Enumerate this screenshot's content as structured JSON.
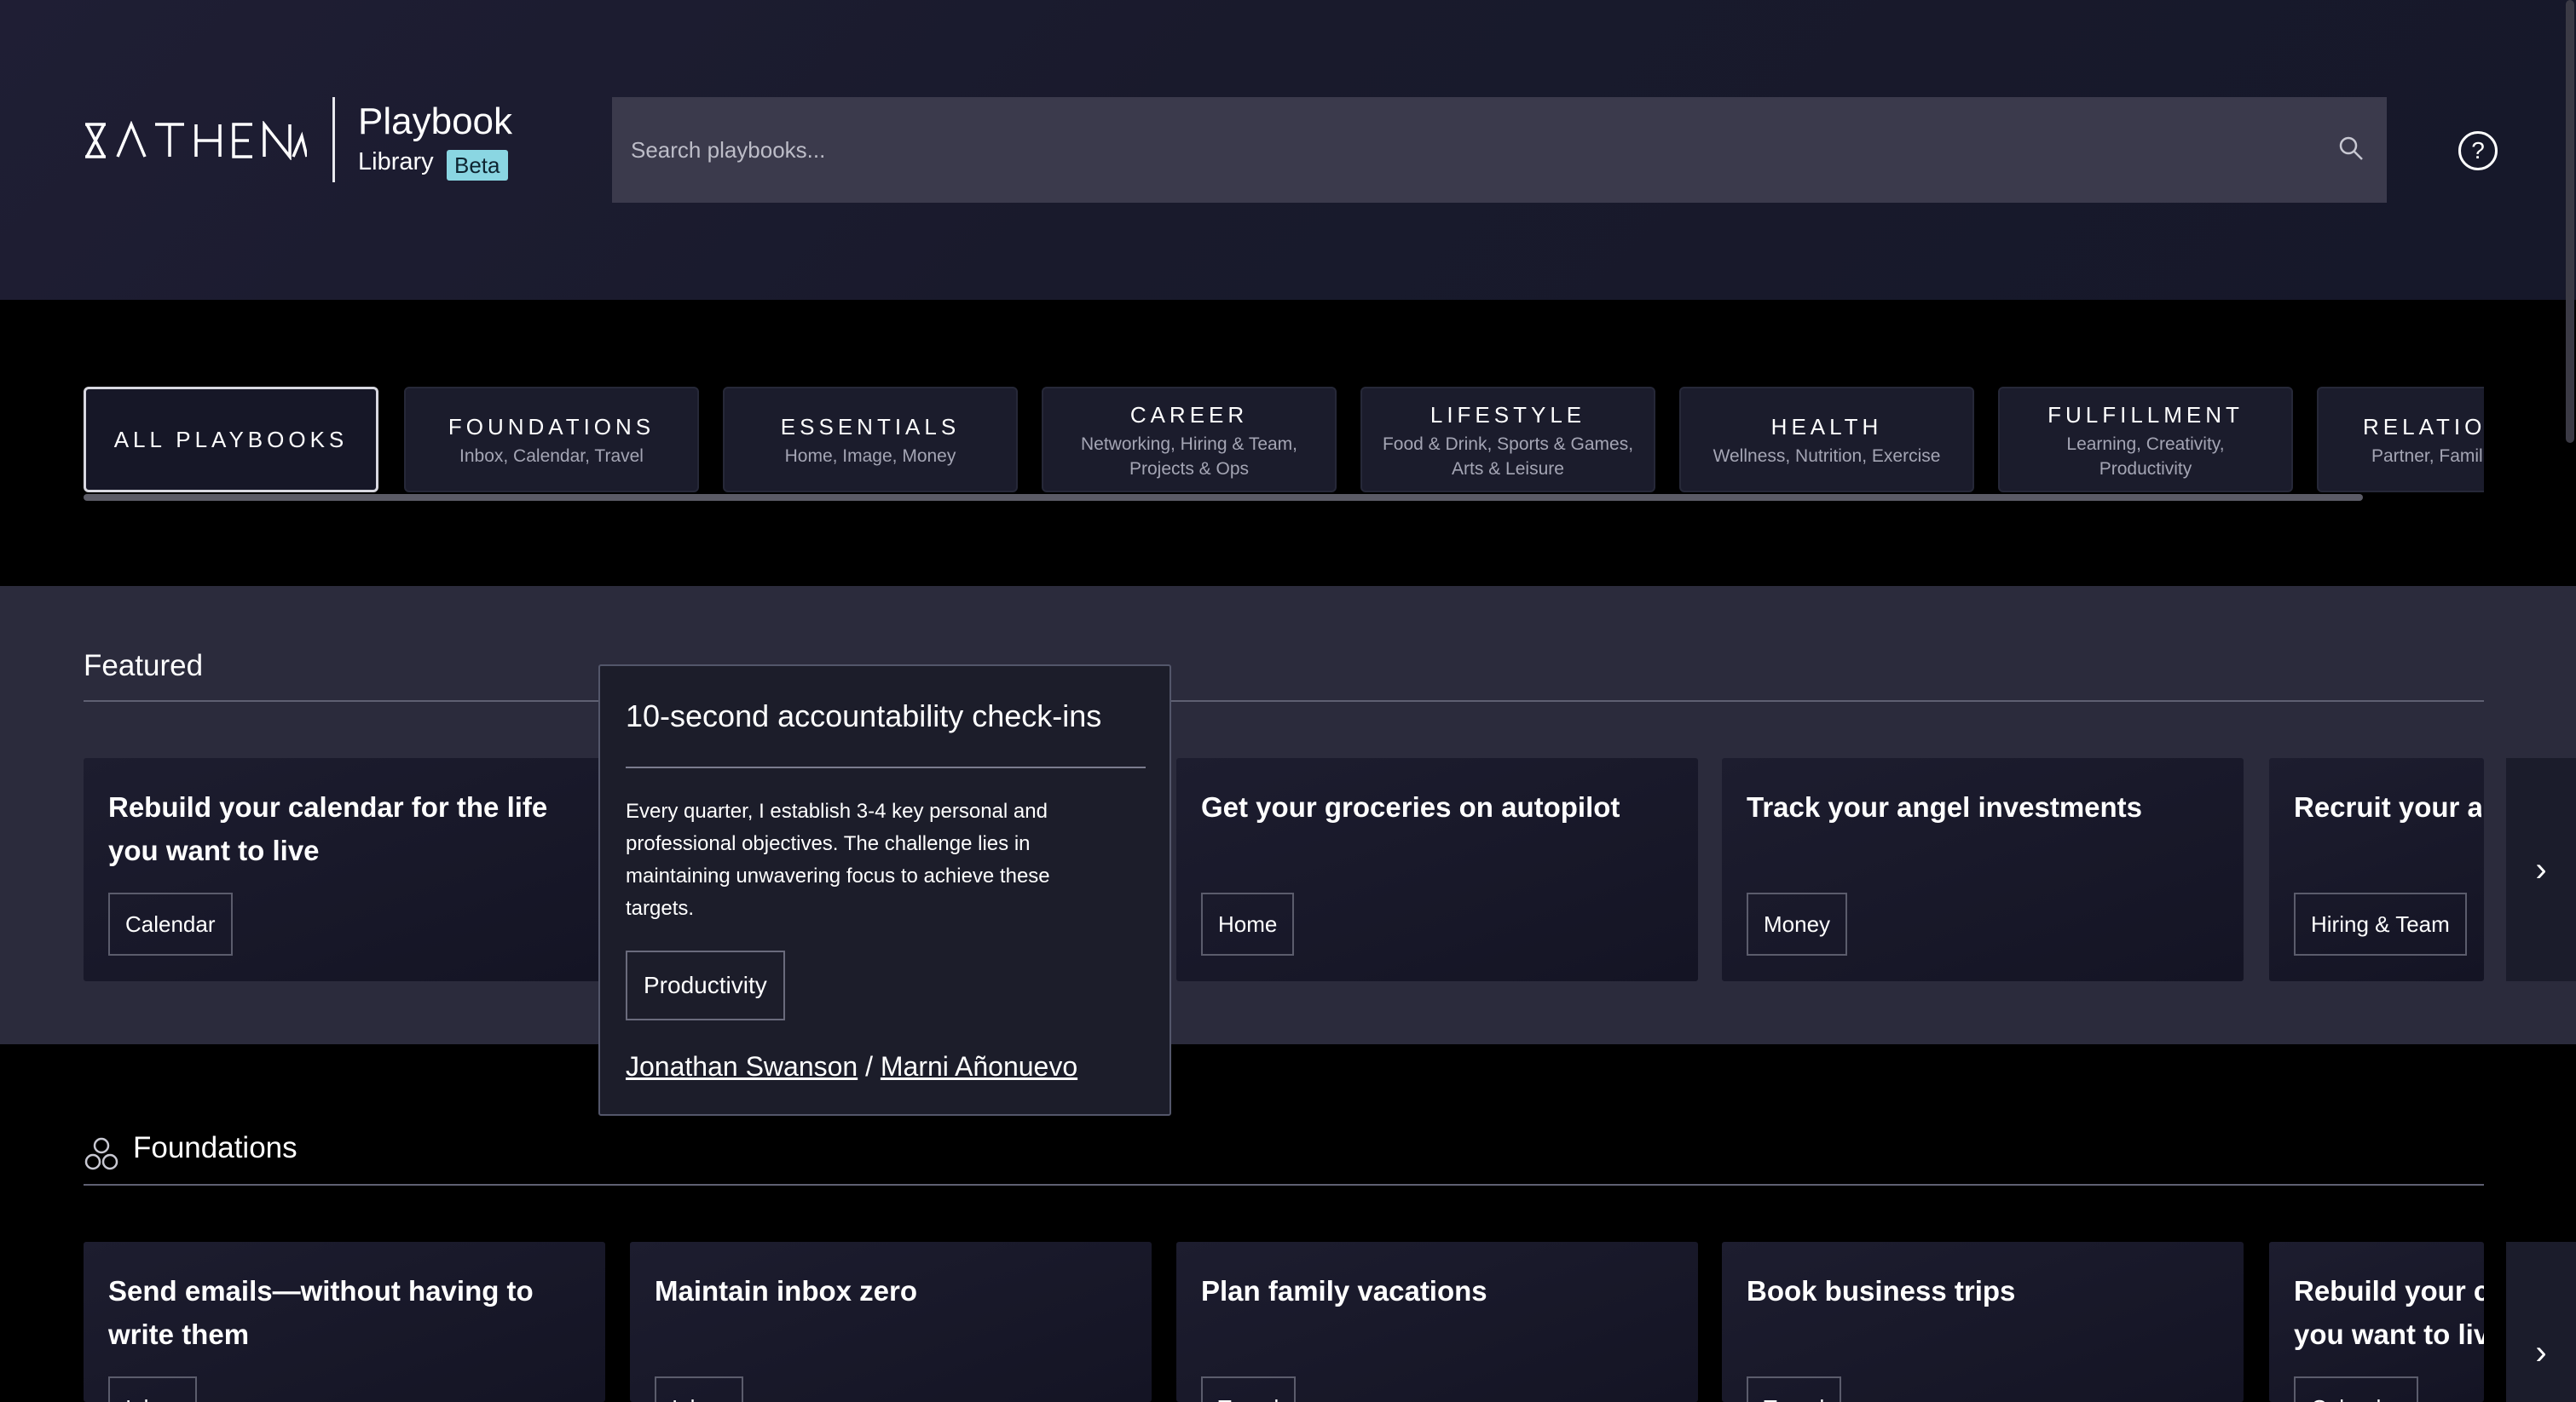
{
  "header": {
    "logo_text": "ATHENA",
    "title": "Playbook",
    "subtitle": "Library",
    "badge": "Beta",
    "search_placeholder": "Search playbooks...",
    "help_label": "?"
  },
  "tabs": [
    {
      "title": "ALL PLAYBOOKS",
      "desc": ""
    },
    {
      "title": "FOUNDATIONS",
      "desc": "Inbox, Calendar, Travel"
    },
    {
      "title": "ESSENTIALS",
      "desc": "Home, Image, Money"
    },
    {
      "title": "CAREER",
      "desc": "Networking, Hiring & Team, Projects & Ops"
    },
    {
      "title": "LIFESTYLE",
      "desc": "Food & Drink, Sports & Games, Arts & Leisure"
    },
    {
      "title": "HEALTH",
      "desc": "Wellness, Nutrition, Exercise"
    },
    {
      "title": "FULFILLMENT",
      "desc": "Learning, Creativity, Productivity"
    },
    {
      "title": "RELATION",
      "desc": "Partner, Famil"
    }
  ],
  "featured": {
    "heading": "Featured",
    "cards": [
      {
        "title": "Rebuild your calendar for the life you want to live",
        "tag": "Calendar"
      },
      {
        "title": "Get your groceries on autopilot",
        "tag": "Home"
      },
      {
        "title": "Track your angel investments",
        "tag": "Money"
      },
      {
        "title": "Recruit your al",
        "tag": "Hiring & Team"
      }
    ],
    "next_label": "›"
  },
  "popover": {
    "title": "10-second accountability check-ins",
    "description": "Every quarter, I establish 3-4 key personal and professional objectives. The challenge lies in maintaining unwavering focus to achieve these targets.",
    "tag": "Productivity",
    "author_1": "Jonathan Swanson",
    "separator": "/",
    "author_2": "Marni Añonuevo"
  },
  "foundations": {
    "heading": "Foundations",
    "cards": [
      {
        "title": "Send emails—without having to write them",
        "tag": "Inbox"
      },
      {
        "title": "Maintain inbox zero",
        "tag": "Inbox"
      },
      {
        "title": "Plan family vacations",
        "tag": "Travel"
      },
      {
        "title": "Book business trips",
        "tag": "Travel"
      },
      {
        "title": "Rebuild your c you want to liv",
        "tag": "Calendar"
      }
    ],
    "next_label": "›"
  }
}
